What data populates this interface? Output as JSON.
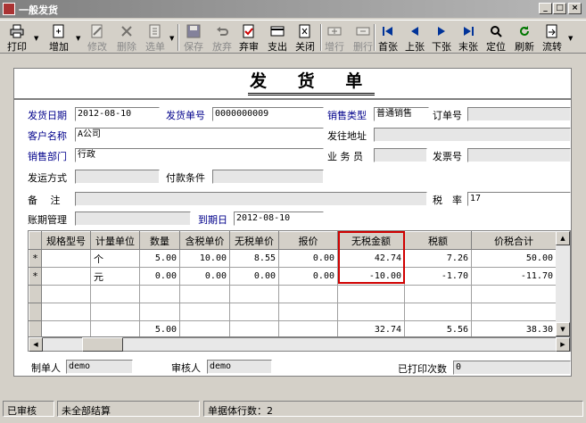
{
  "window": {
    "title": "一般发货"
  },
  "toolbar": {
    "print": "打印",
    "add": "增加",
    "modify": "修改",
    "delete": "删除",
    "select_order": "选单",
    "save": "保存",
    "abandon": "放弃",
    "abandon_review": "弃审",
    "payment": "支出",
    "close": "关闭",
    "add_row": "增行",
    "delete_row": "删行",
    "first": "首张",
    "prev": "上张",
    "next": "下张",
    "last": "末张",
    "locate": "定位",
    "refresh": "刷新",
    "flow": "流转"
  },
  "document": {
    "title": "发 货 单",
    "fields": {
      "ship_date": {
        "label": "发货日期",
        "value": "2012-08-10"
      },
      "ship_no": {
        "label": "发货单号",
        "value": "0000000009"
      },
      "sales_type": {
        "label": "销售类型",
        "value": "普通销售"
      },
      "order_no": {
        "label": "订单号",
        "value": ""
      },
      "customer": {
        "label": "客户名称",
        "value": "A公司"
      },
      "ship_address": {
        "label": "发往地址",
        "value": ""
      },
      "sales_dept": {
        "label": "销售部门",
        "value": "行政"
      },
      "salesperson": {
        "label": "业 务 员",
        "value": ""
      },
      "invoice_no": {
        "label": "发票号",
        "value": ""
      },
      "ship_method": {
        "label": "发运方式",
        "value": ""
      },
      "payment_terms": {
        "label": "付款条件",
        "value": ""
      },
      "remarks": {
        "label": "备　 注",
        "value": ""
      },
      "tax_rate": {
        "label": "税　率",
        "value": "17"
      },
      "account_period": {
        "label": "账期管理",
        "value": ""
      },
      "due_date": {
        "label": "到期日",
        "value": "2012-08-10"
      }
    }
  },
  "table": {
    "columns": [
      "规格型号",
      "计量单位",
      "数量",
      "含税单价",
      "无税单价",
      "报价",
      "无税金额",
      "税额",
      "价税合计"
    ],
    "rows": [
      {
        "marker": "*",
        "cells": [
          "",
          "个",
          "5.00",
          "10.00",
          "8.55",
          "0.00",
          "42.74",
          "7.26",
          "50.00"
        ]
      },
      {
        "marker": "*",
        "cells": [
          "",
          "元",
          "0.00",
          "0.00",
          "0.00",
          "0.00",
          "-10.00",
          "-1.70",
          "-11.70"
        ]
      },
      {
        "marker": "",
        "cells": [
          "",
          "",
          "",
          "",
          "",
          "",
          "",
          "",
          ""
        ]
      },
      {
        "marker": "",
        "cells": [
          "",
          "",
          "",
          "",
          "",
          "",
          "",
          "",
          ""
        ]
      }
    ],
    "totals": {
      "marker": "",
      "cells": [
        "",
        "",
        "5.00",
        "",
        "",
        "",
        "32.74",
        "5.56",
        "38.30"
      ]
    }
  },
  "footer": {
    "maker": {
      "label": "制单人",
      "value": "demo"
    },
    "reviewer": {
      "label": "审核人",
      "value": "demo"
    },
    "print_count": {
      "label": "已打印次数",
      "value": "0"
    }
  },
  "statusbar": {
    "audit": "已审核",
    "settle": "未全部结算",
    "rows": "单据体行数：2"
  },
  "colors": {
    "label_blue": "#00008b",
    "highlight_red": "#d00000",
    "face": "#d4d0c8"
  }
}
